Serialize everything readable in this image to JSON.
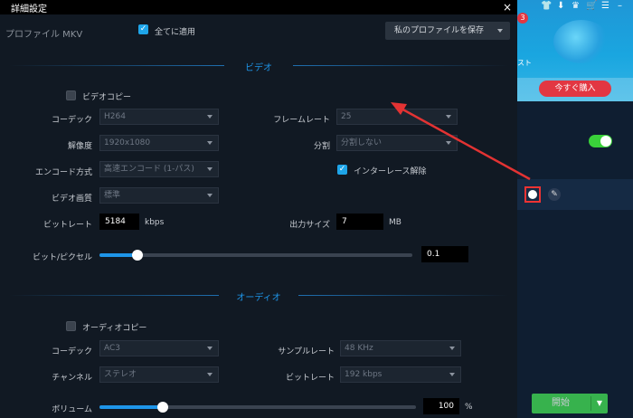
{
  "dialog": {
    "title": "詳細設定",
    "close_glyph": "×",
    "profile_label": "プロファイル MKV",
    "apply_all_label": "全てに適用",
    "apply_all_checked": true,
    "save_profile_label": "私のプロファイルを保存"
  },
  "video": {
    "section_title": "ビデオ",
    "copy_label": "ビデオコピー",
    "copy_checked": false,
    "codec_label": "コーデック",
    "codec_value": "H264",
    "framerate_label": "フレームレート",
    "framerate_value": "25",
    "resolution_label": "解像度",
    "resolution_value": "1920x1080",
    "split_label": "分割",
    "split_value": "分割しない",
    "encode_label": "エンコード方式",
    "encode_value": "高速エンコード (1-パス)",
    "deinterlace_label": "インターレース解除",
    "deinterlace_checked": true,
    "quality_label": "ビデオ画質",
    "quality_value": "標準",
    "bitrate_label": "ビットレート",
    "bitrate_value": "5184",
    "bitrate_unit": "kbps",
    "output_size_label": "出力サイズ",
    "output_size_value": "7",
    "output_size_unit": "MB",
    "bpp_label": "ビット/ピクセル",
    "bpp_value": "0.1",
    "bpp_slider_fraction": 0.12
  },
  "audio": {
    "section_title": "オーディオ",
    "copy_label": "オーディオコピー",
    "copy_checked": false,
    "codec_label": "コーデック",
    "codec_value": "AC3",
    "samplerate_label": "サンプルレート",
    "samplerate_value": "48 KHz",
    "channel_label": "チャンネル",
    "channel_value": "ステレオ",
    "bitrate_label": "ビットレート",
    "bitrate_value": "192 kbps",
    "volume_label": "ボリューム",
    "volume_value": "100",
    "volume_unit": "%",
    "volume_slider_fraction": 0.2
  },
  "side": {
    "notification_count": "3",
    "ad_text": "スト",
    "buy_now_label": "今すぐ購入",
    "toggle_on": true,
    "start_label": "開始",
    "accent_green": "#37b24d",
    "accent_blue": "#1e95e8",
    "annotation_red": "#e33333"
  }
}
